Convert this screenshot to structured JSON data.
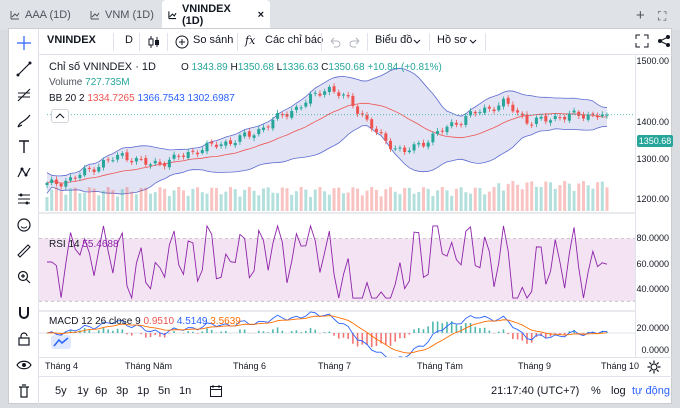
{
  "tabs": [
    {
      "label": "AAA (1D)"
    },
    {
      "label": "VNM (1D)"
    },
    {
      "label": "VNINDEX (1D)"
    }
  ],
  "tab_close": "×",
  "tab_controls": {
    "add": "+",
    "maximize": "⛶"
  },
  "toolbar": {
    "symbol": "VNINDEX",
    "interval": "D",
    "compare": "So sánh",
    "indicators": "Các chỉ báo",
    "chart_type": "Biểu đồ",
    "profile": "Hồ sơ"
  },
  "legend": {
    "title": "Chỉ số VNINDEX · 1D",
    "o_label": "O",
    "o": "1343.89",
    "h_label": "H",
    "h": "1350.68",
    "l_label": "L",
    "l": "1336.63",
    "c_label": "C",
    "c": "1350.68",
    "change": "+10.84 (+0.81%)",
    "volume_label": "Volume",
    "volume": "727.735M",
    "bb_label": "BB 20 2",
    "bb1": "1334.7265",
    "bb2": "1366.7543",
    "bb3": "1302.6987",
    "rsi_label": "RSI 14",
    "rsi": "55.4688",
    "macd_label": "MACD 12 26 close 9",
    "macd1": "0.9510",
    "macd2": "4.5149",
    "macd3": "3.5639"
  },
  "price_axis": [
    "1500.00",
    "1400.00",
    "1350.68",
    "1300.00",
    "1200.00"
  ],
  "rsi_axis": [
    "80.0000",
    "60.0000",
    "40.0000"
  ],
  "macd_axis": [
    "20.0000",
    "0.0000",
    "-20.0000"
  ],
  "x_axis": [
    "Tháng 4",
    "Tháng Năm",
    "Tháng 6",
    "Tháng 7",
    "Tháng Tám",
    "Tháng 9",
    "Tháng 10"
  ],
  "ranges": [
    "5y",
    "1y",
    "6p",
    "3p",
    "1p",
    "5n",
    "1n"
  ],
  "time": "21:17:40 (UTC+7)",
  "scale": {
    "percent": "%",
    "log": "log",
    "auto": "tự động"
  },
  "colors": {
    "up": "#26a69a",
    "down": "#ef5350",
    "bb_fill": "#cfd2ee",
    "bb_line": "#5b6acf",
    "rsi_fill": "#f3e3f3",
    "rsi_line": "#8e24aa",
    "macd": "#2962ff",
    "signal": "#ff6d00"
  },
  "chart_data": {
    "type": "candlestick",
    "x": [
      "Tháng 4",
      "Tháng Năm",
      "Tháng 6",
      "Tháng 7",
      "Tháng Tám",
      "Tháng 9",
      "Tháng 10"
    ],
    "close": [
      1175,
      1190,
      1225,
      1250,
      1225,
      1240,
      1265,
      1280,
      1300,
      1340,
      1375,
      1420,
      1380,
      1300,
      1255,
      1290,
      1330,
      1360,
      1380,
      1330,
      1345,
      1350,
      1351
    ],
    "last_close": 1350.68,
    "price_range": [
      1110,
      1500
    ],
    "rsi_range": [
      25,
      85
    ],
    "macd_range": [
      -30,
      25
    ]
  }
}
